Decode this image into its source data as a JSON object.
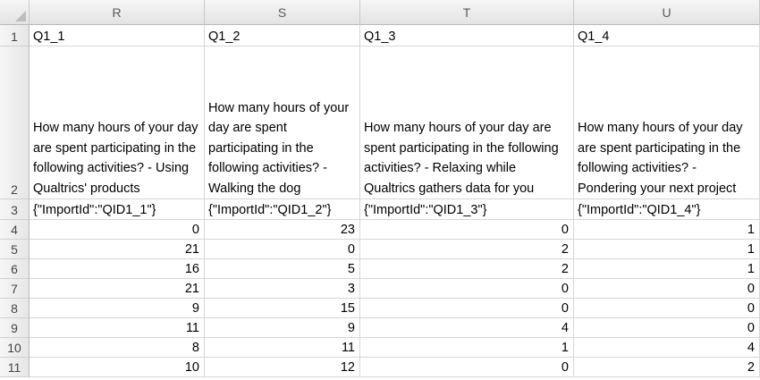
{
  "columns": [
    "R",
    "S",
    "T",
    "U"
  ],
  "rows": [
    "1",
    "2",
    "3",
    "4",
    "5",
    "6",
    "7",
    "8",
    "9",
    "10",
    "11"
  ],
  "cells": {
    "r1": [
      "Q1_1",
      "Q1_2",
      "Q1_3",
      "Q1_4"
    ],
    "r2": [
      "How many hours of your day are spent participating in the following activities? - Using Qualtrics' products",
      "How many hours of your day are spent participating in the following activities? - Walking the dog",
      "How many hours of your day are spent participating in the following activities? - Relaxing while Qualtrics gathers data for you",
      "How many hours of your day are spent participating in the following activities? - Pondering your next project"
    ],
    "r3": [
      "{\"ImportId\":\"QID1_1\"}",
      "{\"ImportId\":\"QID1_2\"}",
      "{\"ImportId\":\"QID1_3\"}",
      "{\"ImportId\":\"QID1_4\"}"
    ],
    "r4": [
      "0",
      "23",
      "0",
      "1"
    ],
    "r5": [
      "21",
      "0",
      "2",
      "1"
    ],
    "r6": [
      "16",
      "5",
      "2",
      "1"
    ],
    "r7": [
      "21",
      "3",
      "0",
      "0"
    ],
    "r8": [
      "9",
      "15",
      "0",
      "0"
    ],
    "r9": [
      "11",
      "9",
      "4",
      "0"
    ],
    "r10": [
      "8",
      "11",
      "1",
      "4"
    ],
    "r11": [
      "10",
      "12",
      "0",
      "2"
    ]
  }
}
